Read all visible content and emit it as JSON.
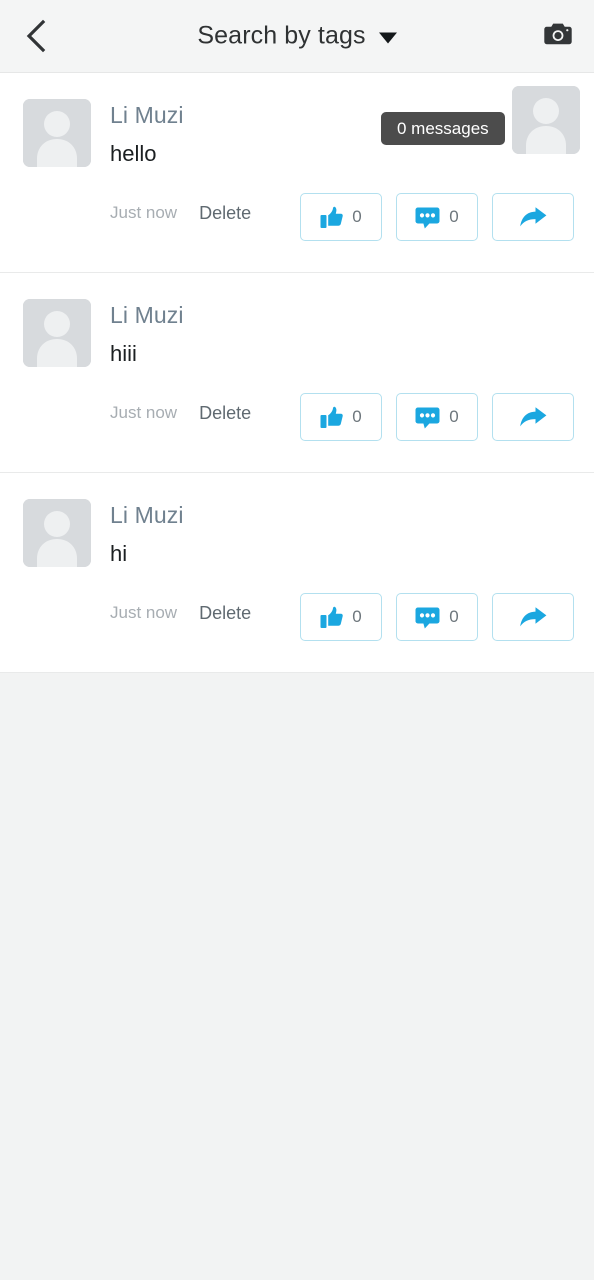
{
  "header": {
    "back_icon": "chevron-left-icon",
    "title": "Search by tags",
    "dropdown_icon": "caret-down-icon",
    "camera_icon": "camera-icon"
  },
  "tooltip": {
    "text": "0 messages"
  },
  "posts": [
    {
      "author": "Li Muzi",
      "content": "hello",
      "time": "Just now",
      "delete_label": "Delete",
      "like_count": "0",
      "comment_count": "0",
      "avatar_icon": "user-placeholder-icon",
      "like_icon": "thumbs-up-icon",
      "comment_icon": "speech-bubble-icon",
      "share_icon": "share-arrow-icon"
    },
    {
      "author": "Li Muzi",
      "content": "hiii",
      "time": "Just now",
      "delete_label": "Delete",
      "like_count": "0",
      "comment_count": "0",
      "avatar_icon": "user-placeholder-icon",
      "like_icon": "thumbs-up-icon",
      "comment_icon": "speech-bubble-icon",
      "share_icon": "share-arrow-icon"
    },
    {
      "author": "Li Muzi",
      "content": "hi",
      "time": "Just now",
      "delete_label": "Delete",
      "like_count": "0",
      "comment_count": "0",
      "avatar_icon": "user-placeholder-icon",
      "like_icon": "thumbs-up-icon",
      "comment_icon": "speech-bubble-icon",
      "share_icon": "share-arrow-icon"
    }
  ],
  "colors": {
    "accent_blue": "#1ba7e0",
    "button_border": "#b3e0ef",
    "header_bg": "#f4f5f5",
    "page_bg": "#f2f3f3",
    "author_text": "#70818f",
    "tooltip_bg": "#4c4c4c",
    "avatar_bg": "#d7dadd"
  }
}
